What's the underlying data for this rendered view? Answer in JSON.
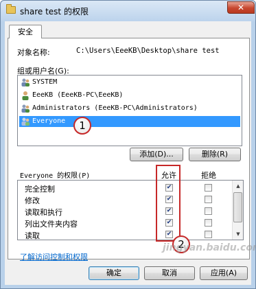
{
  "window": {
    "title": "share test 的权限",
    "close_glyph": "✕"
  },
  "tab": {
    "label": "安全"
  },
  "object": {
    "label": "对象名称:",
    "path": "C:\\Users\\EeeKB\\Desktop\\share test"
  },
  "groups": {
    "label": "组或用户名(G):",
    "items": [
      {
        "label": "SYSTEM"
      },
      {
        "label": "EeeKB (EeeKB-PC\\EeeKB)"
      },
      {
        "label": "Administrators (EeeKB-PC\\Administrators)"
      },
      {
        "label": "Everyone",
        "selected": true
      }
    ]
  },
  "buttons": {
    "add": "添加(D)...",
    "remove": "删除(R)",
    "ok": "确定",
    "cancel": "取消",
    "apply": "应用(A)"
  },
  "permissions": {
    "label": "Everyone 的权限(P)",
    "allow_header": "允许",
    "deny_header": "拒绝",
    "rows": [
      {
        "name": "完全控制",
        "allow": true,
        "deny": false
      },
      {
        "name": "修改",
        "allow": true,
        "deny": false
      },
      {
        "name": "读取和执行",
        "allow": true,
        "deny": false
      },
      {
        "name": "列出文件夹内容",
        "allow": true,
        "deny": false
      },
      {
        "name": "读取",
        "allow": true,
        "deny": false
      }
    ]
  },
  "link": {
    "label": "了解访问控制和权限"
  },
  "callouts": {
    "one": "1",
    "two": "2"
  },
  "watermark": {
    "text": "jingyan.baidu.com"
  },
  "colors": {
    "selection": "#3399ff",
    "annotation_red": "#c62828",
    "link": "#0066cc"
  }
}
